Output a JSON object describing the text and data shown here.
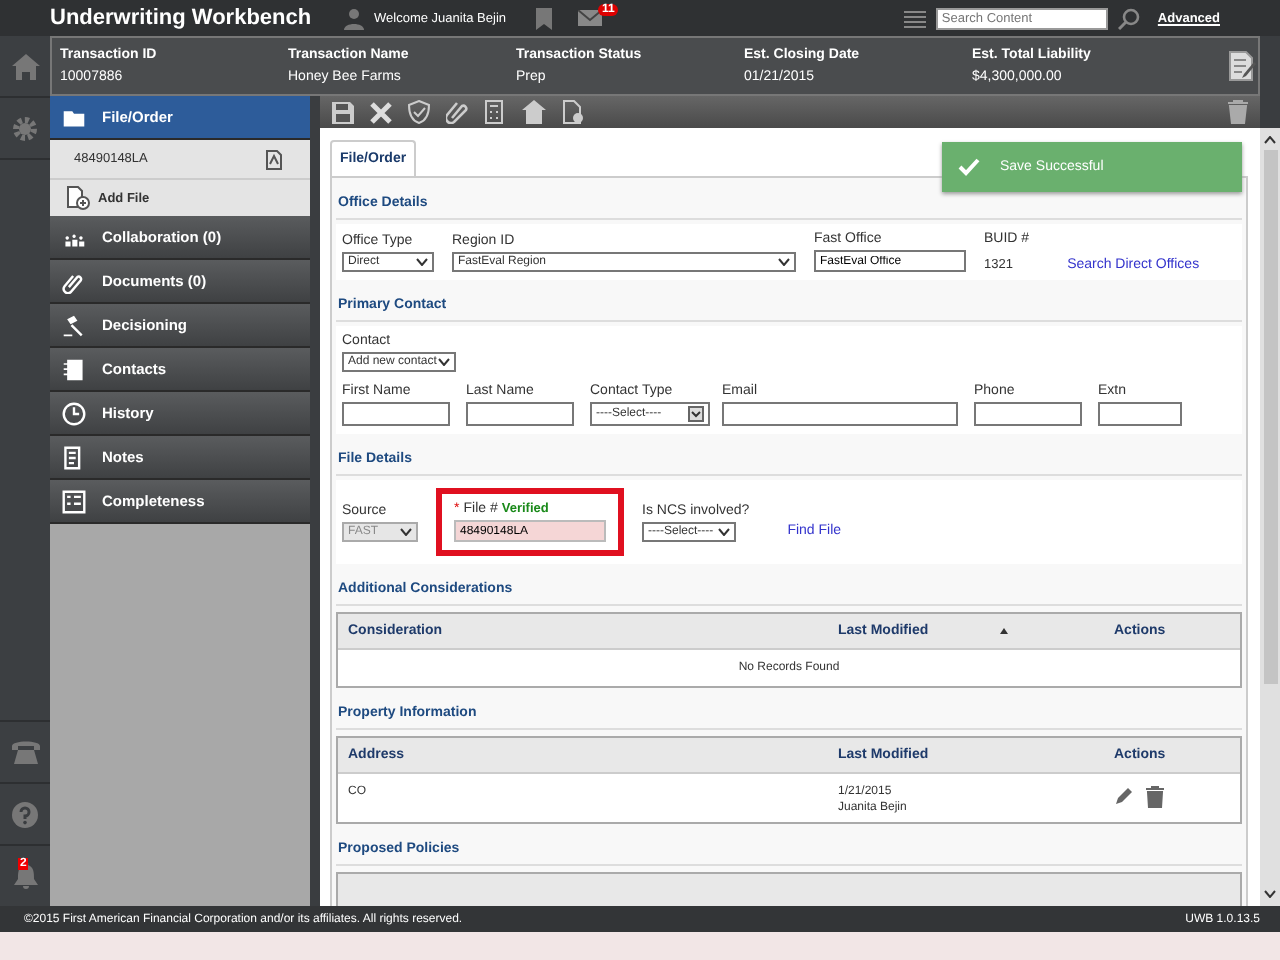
{
  "app": {
    "title": "Underwriting Workbench",
    "welcome": "Welcome Juanita Bejin",
    "mail_count": "11",
    "search": {
      "placeholder": "Search Content"
    },
    "advanced_link": "Advanced"
  },
  "rail": {
    "alert_count": "2"
  },
  "transaction": {
    "columns": [
      {
        "label": "Transaction ID",
        "value": "10007886"
      },
      {
        "label": "Transaction Name",
        "value": "Honey Bee Farms"
      },
      {
        "label": "Transaction Status",
        "value": "Prep"
      },
      {
        "label": "Est. Closing Date",
        "value": "01/21/2015"
      },
      {
        "label": "Est. Total Liability",
        "value": "$4,300,000.00"
      }
    ]
  },
  "sidebar": {
    "items": [
      {
        "label": "File/Order",
        "selected": true,
        "children": [
          {
            "kind": "file",
            "label": "48490148LA"
          },
          {
            "kind": "action",
            "label": "Add File"
          }
        ]
      },
      {
        "label": "Collaboration (0)",
        "selected": false
      },
      {
        "label": "Documents (0)",
        "selected": false
      },
      {
        "label": "Decisioning",
        "selected": false
      },
      {
        "label": "Contacts",
        "selected": false
      },
      {
        "label": "History",
        "selected": false
      },
      {
        "label": "Notes",
        "selected": false
      },
      {
        "label": "Completeness",
        "selected": false
      }
    ]
  },
  "tabs": [
    {
      "label": "File/Order",
      "selected": true
    }
  ],
  "toast": {
    "message": "Save Successful"
  },
  "office_details": {
    "title": "Office Details",
    "office_type": {
      "label": "Office Type",
      "value": "Direct"
    },
    "region_id": {
      "label": "Region ID",
      "value": "FastEval Region"
    },
    "fast_office": {
      "label": "Fast Office",
      "value": "FastEval Office"
    },
    "buid": {
      "label": "BUID #",
      "value": "1321"
    },
    "link": "Search Direct Offices"
  },
  "primary_contact": {
    "title": "Primary Contact",
    "contact": {
      "label": "Contact",
      "value": "Add new contact"
    },
    "fields": [
      {
        "kind": "text",
        "label": "First Name"
      },
      {
        "kind": "text",
        "label": "Last Name"
      },
      {
        "kind": "select",
        "label": "Contact Type",
        "value": "----Select----"
      },
      {
        "kind": "text",
        "label": "Email"
      },
      {
        "kind": "text",
        "label": "Phone"
      },
      {
        "kind": "text",
        "label": "Extn"
      }
    ]
  },
  "file_details": {
    "title": "File Details",
    "source": {
      "label": "Source",
      "value": "FAST",
      "disabled": true
    },
    "file_number": {
      "required_mark": "*",
      "label": "File #",
      "status": "Verified",
      "value": "48490148LA",
      "highlighted": true
    },
    "ncs": {
      "label": "Is NCS involved?",
      "value": "----Select----"
    },
    "link": "Find File"
  },
  "additional_considerations": {
    "title": "Additional Considerations",
    "columns": [
      {
        "label": "Consideration",
        "sorted": false
      },
      {
        "label": "Last Modified",
        "sorted": true
      },
      {
        "label": "Actions",
        "sorted": false
      }
    ],
    "empty_message": "No Records Found"
  },
  "property_information": {
    "title": "Property Information",
    "columns": [
      {
        "label": "Address"
      },
      {
        "label": "Last Modified"
      },
      {
        "label": "Actions"
      }
    ],
    "rows": [
      {
        "address": "CO",
        "date": "1/21/2015",
        "user": "Juanita Bejin"
      }
    ]
  },
  "proposed_policies": {
    "title": "Proposed Policies"
  },
  "footer": {
    "copyright": "©2015 First American Financial Corporation and/or its affiliates. All rights reserved.",
    "version": "UWB 1.0.13.5"
  }
}
